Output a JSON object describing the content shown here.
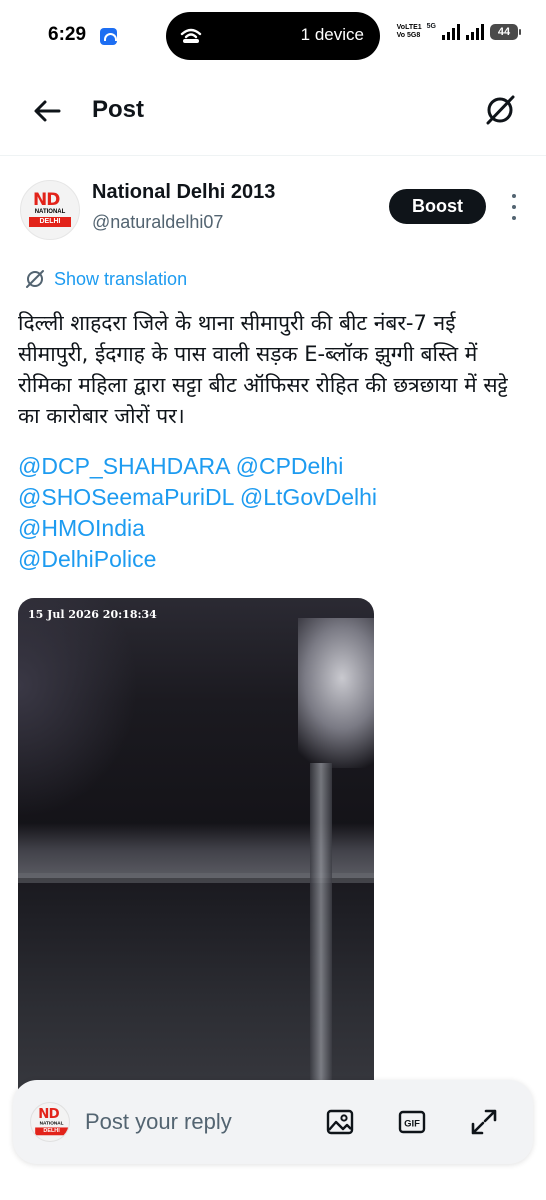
{
  "status_bar": {
    "time": "6:29",
    "island_text": "1 device",
    "network_label": "VoLTE1 Vo 5G8",
    "network_type": "5G",
    "battery": "44"
  },
  "header": {
    "title": "Post"
  },
  "post": {
    "author_name": "National Delhi 2013",
    "author_handle": "@naturaldelhi07",
    "boost_label": "Boost",
    "show_translation": "Show translation",
    "text": "दिल्ली शाहदरा जिले के थाना सीमापुरी की बीट नंबर-7 नई सीमापुरी, ईदगाह के पास वाली सड़क E-ब्लॉक झुग्गी बस्ति में रोमिका महिला द्वारा सट्टा बीट ऑफिसर रोहित की छत्रछाया में सट्टे का कारोबार जोरों पर।",
    "mentions": [
      "@DCP_SHAHDARA",
      "@CPDelhi",
      "@SHOSeemaPuriDL",
      "@LtGovDelhi",
      "@HMOIndia",
      "@DelhiPolice"
    ],
    "media_timestamp": "15 Jul 2026 20:18:34",
    "logo_text": {
      "mark": "ND",
      "line1": "NATIONAL",
      "line2": "DELHI"
    }
  },
  "reply": {
    "placeholder": "Post your reply",
    "gif_label": "GIF"
  },
  "colors": {
    "accent": "#1d9bf0",
    "text": "#0f1419",
    "secondary": "#536471",
    "brand_red": "#e2231a"
  },
  "icons": [
    "back-arrow-icon",
    "grok-icon",
    "more-vertical-icon",
    "translate-icon",
    "image-icon",
    "gif-icon",
    "expand-icon"
  ]
}
